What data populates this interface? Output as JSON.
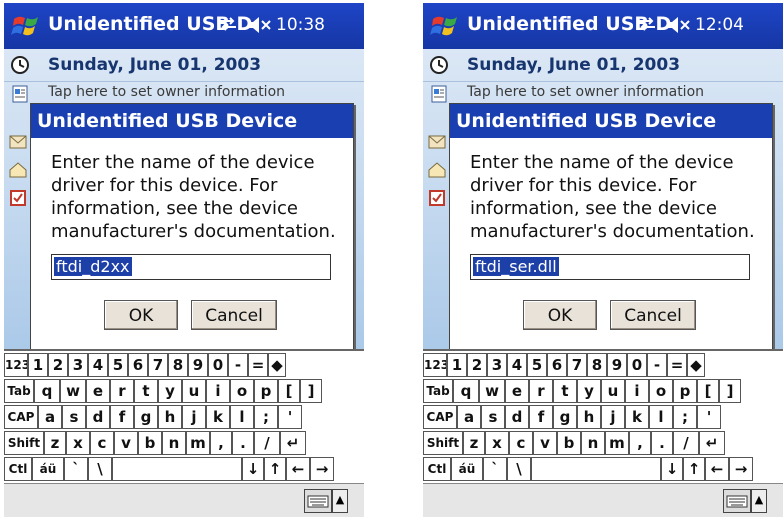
{
  "screens": [
    {
      "title": "Unidentified USB D",
      "time": "10:38",
      "date": "Sunday, June 01, 2003",
      "owner_info": "Tap here to set owner information",
      "dialog": {
        "title": "Unidentified USB Device",
        "message": "Enter the name of the device driver for this device. For information, see the device manufacturer's documentation.",
        "input_value": "ftdi_d2xx",
        "ok_label": "OK",
        "cancel_label": "Cancel"
      }
    },
    {
      "title": "Unidentified USB D",
      "time": "12:04",
      "date": "Sunday, June 01, 2003",
      "owner_info": "Tap here to set owner information",
      "dialog": {
        "title": "Unidentified USB Device",
        "message": "Enter the name of the device driver for this device. For information, see the device manufacturer's documentation.",
        "input_value": "ftdi_ser.dll",
        "ok_label": "OK",
        "cancel_label": "Cancel"
      }
    }
  ],
  "keyboard": {
    "rows": [
      [
        "123",
        "1",
        "2",
        "3",
        "4",
        "5",
        "6",
        "7",
        "8",
        "9",
        "0",
        "-",
        "=",
        "◆"
      ],
      [
        "Tab",
        "q",
        "w",
        "e",
        "r",
        "t",
        "y",
        "u",
        "i",
        "o",
        "p",
        "[",
        "]"
      ],
      [
        "CAP",
        "a",
        "s",
        "d",
        "f",
        "g",
        "h",
        "j",
        "k",
        "l",
        ";",
        "'"
      ],
      [
        "Shift",
        "z",
        "x",
        "c",
        "v",
        "b",
        "n",
        "m",
        ",",
        ".",
        "/",
        "↵"
      ],
      [
        "Ctl",
        "áü",
        "`",
        "\\",
        "",
        "↓",
        "↑",
        "←",
        "→"
      ]
    ]
  },
  "icons": {
    "start": "windows-flag-icon",
    "sync": "sync-arrows-icon",
    "volume": "speaker-muted-icon",
    "clock": "clock-icon",
    "owner": "contact-card-icon",
    "keyboard_toggle": "keyboard-icon",
    "sip_arrow": "up-arrow-icon"
  },
  "colors": {
    "titlebar": "#1f45c7",
    "dialog_title": "#1a3fb0",
    "selection": "#1c3fa8"
  }
}
